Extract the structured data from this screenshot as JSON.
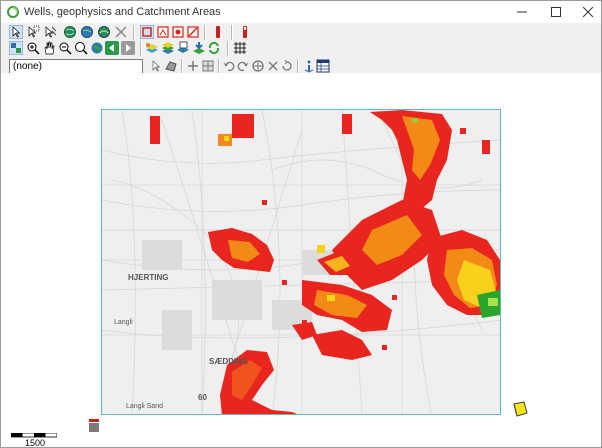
{
  "window": {
    "title": "Wells, geophysics and Catchment Areas"
  },
  "toolbar": {
    "layer_select_value": "(none)"
  },
  "map": {
    "labels": [
      "HJERTING",
      "SÆDDING",
      "Langli Sand",
      "Langli",
      "60"
    ]
  },
  "scale": {
    "label": "1500"
  },
  "colors": {
    "accent_frame": "#5fb8c5",
    "heat_red": "#e8251e",
    "heat_orange": "#f38a16",
    "heat_yellow": "#f7d11c",
    "heat_green": "#2aa52a"
  }
}
